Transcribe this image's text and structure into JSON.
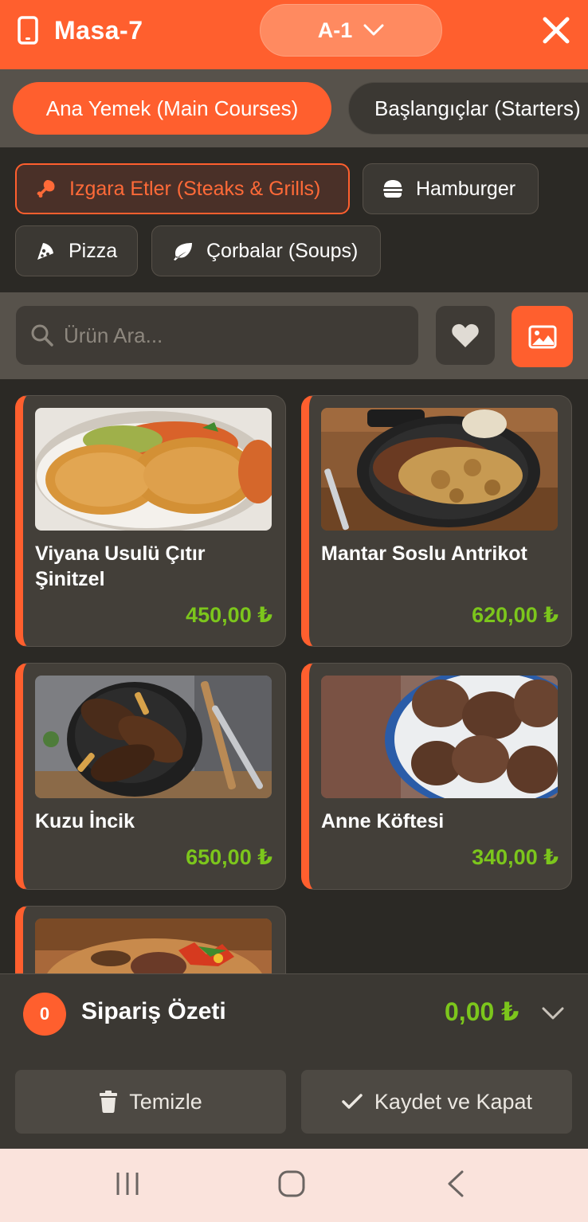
{
  "header": {
    "title": "Masa-7",
    "table": "A-1",
    "icons": {
      "left": "phone-icon",
      "right": "close-icon",
      "dropdown": "chevron-down-icon"
    },
    "color": "#ff5f2e"
  },
  "categories": [
    {
      "label": "Ana Yemek (Main Courses)",
      "active": true
    },
    {
      "label": "Başlangıçlar (Starters)",
      "active": false
    }
  ],
  "subcategories": [
    {
      "label": "Izgara Etler (Steaks & Grills)",
      "icon": "drumstick-icon",
      "active": true
    },
    {
      "label": "Hamburger",
      "icon": "hamburger-icon",
      "active": false
    },
    {
      "label": "Pizza",
      "icon": "pizza-icon",
      "active": false
    },
    {
      "label": "Çorbalar (Soups)",
      "icon": "leaf-icon",
      "active": false
    }
  ],
  "search": {
    "placeholder": "Ürün Ara...",
    "value": ""
  },
  "products": [
    {
      "name": "Viyana Usulü Çıtır Şinitzel",
      "price": "450,00 ₺"
    },
    {
      "name": "Mantar Soslu Antrikot",
      "price": "620,00 ₺"
    },
    {
      "name": "Kuzu İncik",
      "price": "650,00 ₺"
    },
    {
      "name": "Anne Köftesi",
      "price": "340,00 ₺"
    },
    {
      "name": "",
      "price": ""
    }
  ],
  "summary": {
    "count": "0",
    "title": "Sipariş Özeti",
    "total": "0,00 ₺",
    "clear_label": "Temizle",
    "save_label": "Kaydet ve Kapat"
  },
  "colors": {
    "accent": "#ff5f2e",
    "price": "#7cc61c",
    "background": "#2b2925"
  }
}
